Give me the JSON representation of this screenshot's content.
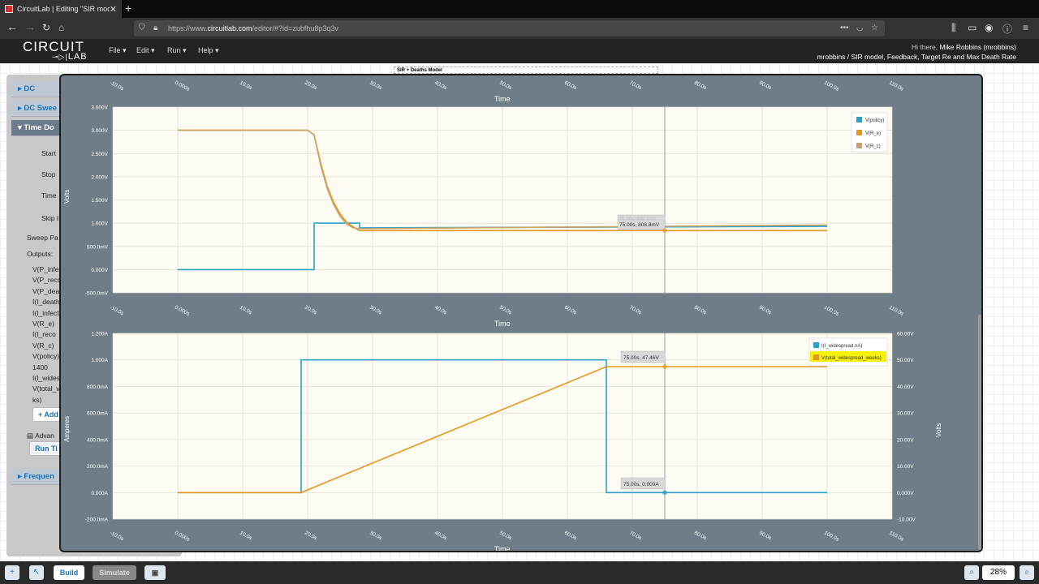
{
  "browser": {
    "tab_title": "CircuitLab | Editing \"SIR model",
    "url_prefix": "https://www.",
    "url_domain": "circuitlab.com",
    "url_path": "/editor/#?id=zubfhu8p3q3v"
  },
  "header": {
    "logo_top": "CIRCUIT",
    "logo_bottom": "LAB",
    "menus": [
      "File",
      "Edit",
      "Run",
      "Help"
    ],
    "greeting": "Hi there, ",
    "user_name": "Mike Robbins (mrobbins)",
    "breadcrumb": "mrobbins / SIR model, Feedback, Target Re and Max Death Rate"
  },
  "canvas": {
    "sim_title": "SIR + Deaths Model"
  },
  "sim_panel": {
    "sections": [
      "DC",
      "DC Swee",
      "Time Do",
      "Frequen"
    ],
    "params": [
      "Start",
      "Stop",
      "Time",
      "Skip I"
    ],
    "sweep_label": "Sweep Pa",
    "outputs_label": "Outputs:",
    "outputs": [
      "V(P_infe",
      "V(P_reco",
      "V(P_dea",
      "I(I_death",
      "I(I_infect",
      "V(R_e)",
      "I(I_reco",
      "V(R_c)",
      "V(policy)",
      "1400",
      "I(I_wides",
      "V(total_v",
      "ks)"
    ],
    "add_label": "+ Add",
    "advanced_label": "Advan",
    "run_label": "Run Ti"
  },
  "charts": {
    "colors": {
      "bg": "#fdfcf2",
      "window": "#6e7d87",
      "blue": "#2aa1c9",
      "orange": "#e69620",
      "tan": "#c9a46a"
    },
    "x_axis_title": "Time",
    "x_ticks": [
      "-10.0s",
      "0.000s",
      "10.0s",
      "20.0s",
      "30.0s",
      "40.0s",
      "50.0s",
      "60.0s",
      "70.0s",
      "80.0s",
      "90.0s",
      "100.0s",
      "110.0s"
    ],
    "top": {
      "y_title": "Volts",
      "y_ticks": [
        "3.500V",
        "3.000V",
        "2.500V",
        "2.000V",
        "1.500V",
        "1.000V",
        "500.0mV",
        "0.000V",
        "-500.0mV"
      ],
      "legend": [
        "V(policy)",
        "V(R_e)",
        "V(R_c)"
      ],
      "cursor_label": "75.00s, 808.8mV",
      "cursor_ghost": "75.00s, 935.1mV"
    },
    "bottom": {
      "y_title": "Amperes",
      "y2_title": "Volts",
      "y_ticks": [
        "1.200A",
        "1.000A",
        "800.0mA",
        "600.0mA",
        "400.0mA",
        "200.0mA",
        "0.000A",
        "-200.0mA"
      ],
      "y2_ticks": [
        "60.00V",
        "50.00V",
        "40.00V",
        "30.00V",
        "20.00V",
        "10.00V",
        "0.000V",
        "-10.00V"
      ],
      "legend": [
        "I(I_widespread.nA)",
        "V(total_widespread_weeks)"
      ],
      "cursor_label_top": "75.00s, 47.46V",
      "cursor_label_bottom": "75.00s, 0.000A"
    }
  },
  "chart_data": [
    {
      "type": "line",
      "title": "",
      "xlabel": "Time",
      "ylabel": "Volts",
      "xlim": [
        -10,
        110
      ],
      "ylim": [
        -0.5,
        3.5
      ],
      "series": [
        {
          "name": "V(policy)",
          "color": "#2aa1c9",
          "x": [
            0,
            21,
            21,
            28,
            28,
            100
          ],
          "y": [
            0,
            0,
            1.0,
            1.0,
            0.9,
            0.93
          ]
        },
        {
          "name": "V(R_e)",
          "color": "#e69620",
          "x": [
            0,
            20,
            21,
            22,
            23,
            24,
            25,
            26,
            27,
            28,
            100
          ],
          "y": [
            3.0,
            3.0,
            2.9,
            2.3,
            1.8,
            1.45,
            1.2,
            1.02,
            0.92,
            0.84,
            0.84
          ]
        },
        {
          "name": "V(R_c)",
          "color": "#c9a46a",
          "x": [
            0,
            20,
            21,
            22,
            23,
            24,
            25,
            26,
            27,
            28,
            100
          ],
          "y": [
            3.0,
            3.0,
            2.9,
            2.25,
            1.75,
            1.4,
            1.15,
            0.98,
            0.9,
            0.88,
            0.96
          ]
        }
      ]
    },
    {
      "type": "line",
      "title": "",
      "xlabel": "Time",
      "ylabel": "Amperes",
      "y2label": "Volts",
      "xlim": [
        -10,
        110
      ],
      "ylim": [
        -0.2,
        1.2
      ],
      "y2lim": [
        -10,
        60
      ],
      "series": [
        {
          "name": "I(I_widespread.nA)",
          "color": "#2aa1c9",
          "axis": "left",
          "x": [
            0,
            19,
            19,
            66,
            66,
            100
          ],
          "y": [
            0,
            0,
            1.0,
            1.0,
            0,
            0
          ]
        },
        {
          "name": "V(total_widespread_weeks)",
          "color": "#e69620",
          "axis": "right",
          "x": [
            0,
            19,
            66,
            100
          ],
          "y": [
            0,
            0,
            47.46,
            47.46
          ]
        }
      ]
    }
  ],
  "bottom_bar": {
    "build_label": "Build",
    "simulate_label": "Simulate",
    "zoom": "28%"
  }
}
